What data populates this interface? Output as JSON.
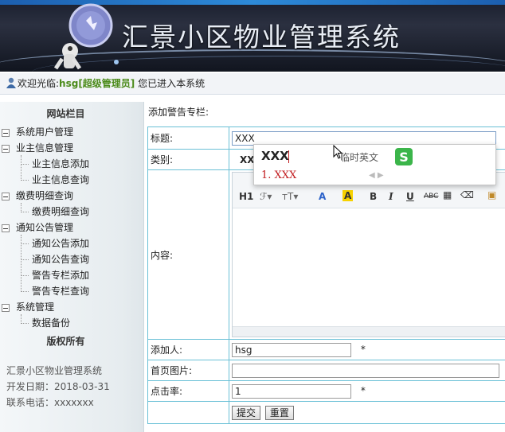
{
  "header": {
    "title": "汇景小区物业管理系统"
  },
  "infobar": {
    "prefix": "欢迎光临:",
    "user": "hsg[超级管理员]",
    "suffix": "您已进入本系统"
  },
  "sidebar": {
    "title": "网站栏目",
    "groups": [
      {
        "label": "系统用户管理",
        "children": []
      },
      {
        "label": "业主信息管理",
        "children": [
          "业主信息添加",
          "业主信息查询"
        ]
      },
      {
        "label": "缴费明细查询",
        "children": [
          "缴费明细查询"
        ]
      },
      {
        "label": "通知公告管理",
        "children": [
          "通知公告添加",
          "通知公告查询",
          "警告专栏添加",
          "警告专栏查询"
        ]
      },
      {
        "label": "系统管理",
        "children": [
          "数据备份"
        ]
      }
    ],
    "copyright": "版权所有",
    "info": [
      "汇景小区物业管理系统",
      "开发日期：2018-03-31",
      "联系电话：xxxxxxx"
    ]
  },
  "main": {
    "title": "添加警告专栏:",
    "form": {
      "title_label": "标题:",
      "title_value": "XXX",
      "category_label": "类别:",
      "category_value": "XX",
      "content_label": "内容:",
      "adder_label": "添加人:",
      "adder_value": "hsg",
      "image_label": "首页图片:",
      "image_value": "",
      "clicks_label": "点击率:",
      "clicks_value": "1",
      "required_mark": "*",
      "submit_label": "提交",
      "reset_label": "重置"
    },
    "editor_toolbar": [
      "H1",
      "A",
      "A",
      "B",
      "I",
      "U",
      "ABC"
    ]
  },
  "ime": {
    "composition": "XXX",
    "hint": "临时英文",
    "candidate": "1. XXX"
  },
  "colors": {
    "border": "#6ac0d6",
    "user_green": "#4b8b1a",
    "candidate_red": "#c0191c",
    "banner_dark": "#1a1f2e"
  }
}
